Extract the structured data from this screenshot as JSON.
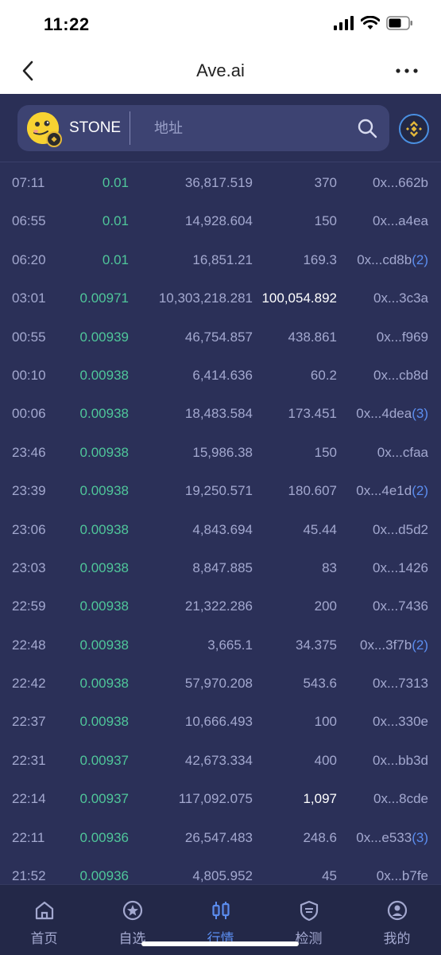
{
  "status_bar": {
    "time": "11:22"
  },
  "nav": {
    "title": "Ave.ai"
  },
  "header": {
    "token_name": "STONE",
    "search_placeholder": "地址"
  },
  "colors": {
    "price_green": "#4fc69a",
    "accent_blue": "#5b8def",
    "background": "#2b3058",
    "highlight_white": "#ffffff"
  },
  "trades": [
    {
      "time": "07:11",
      "price": "0.01",
      "amount": "36,817.519",
      "value": "370",
      "address": "0x...662b",
      "count": ""
    },
    {
      "time": "06:55",
      "price": "0.01",
      "amount": "14,928.604",
      "value": "150",
      "address": "0x...a4ea",
      "count": ""
    },
    {
      "time": "06:20",
      "price": "0.01",
      "amount": "16,851.21",
      "value": "169.3",
      "address": "0x...cd8b",
      "count": "(2)"
    },
    {
      "time": "03:01",
      "price": "0.00971",
      "amount": "10,303,218.281",
      "value": "100,054.892",
      "address": "0x...3c3a",
      "count": ""
    },
    {
      "time": "00:55",
      "price": "0.00939",
      "amount": "46,754.857",
      "value": "438.861",
      "address": "0x...f969",
      "count": ""
    },
    {
      "time": "00:10",
      "price": "0.00938",
      "amount": "6,414.636",
      "value": "60.2",
      "address": "0x...cb8d",
      "count": ""
    },
    {
      "time": "00:06",
      "price": "0.00938",
      "amount": "18,483.584",
      "value": "173.451",
      "address": "0x...4dea",
      "count": "(3)"
    },
    {
      "time": "23:46",
      "price": "0.00938",
      "amount": "15,986.38",
      "value": "150",
      "address": "0x...cfaa",
      "count": ""
    },
    {
      "time": "23:39",
      "price": "0.00938",
      "amount": "19,250.571",
      "value": "180.607",
      "address": "0x...4e1d",
      "count": "(2)"
    },
    {
      "time": "23:06",
      "price": "0.00938",
      "amount": "4,843.694",
      "value": "45.44",
      "address": "0x...d5d2",
      "count": ""
    },
    {
      "time": "23:03",
      "price": "0.00938",
      "amount": "8,847.885",
      "value": "83",
      "address": "0x...1426",
      "count": ""
    },
    {
      "time": "22:59",
      "price": "0.00938",
      "amount": "21,322.286",
      "value": "200",
      "address": "0x...7436",
      "count": ""
    },
    {
      "time": "22:48",
      "price": "0.00938",
      "amount": "3,665.1",
      "value": "34.375",
      "address": "0x...3f7b",
      "count": "(2)"
    },
    {
      "time": "22:42",
      "price": "0.00938",
      "amount": "57,970.208",
      "value": "543.6",
      "address": "0x...7313",
      "count": ""
    },
    {
      "time": "22:37",
      "price": "0.00938",
      "amount": "10,666.493",
      "value": "100",
      "address": "0x...330e",
      "count": ""
    },
    {
      "time": "22:31",
      "price": "0.00937",
      "amount": "42,673.334",
      "value": "400",
      "address": "0x...bb3d",
      "count": ""
    },
    {
      "time": "22:14",
      "price": "0.00937",
      "amount": "117,092.075",
      "value": "1,097",
      "address": "0x...8cde",
      "count": ""
    },
    {
      "time": "22:11",
      "price": "0.00936",
      "amount": "26,547.483",
      "value": "248.6",
      "address": "0x...e533",
      "count": "(3)"
    },
    {
      "time": "21:52",
      "price": "0.00936",
      "amount": "4,805.952",
      "value": "45",
      "address": "0x...b7fe",
      "count": ""
    }
  ],
  "highlighted_values": [
    "100,054.892",
    "1,097"
  ],
  "tabbar": {
    "tabs": [
      {
        "label": "首页",
        "icon": "home-icon",
        "active": false
      },
      {
        "label": "自选",
        "icon": "star-icon",
        "active": false
      },
      {
        "label": "行情",
        "icon": "candlestick-icon",
        "active": true
      },
      {
        "label": "检测",
        "icon": "shield-icon",
        "active": false
      },
      {
        "label": "我的",
        "icon": "user-icon",
        "active": false
      }
    ]
  }
}
